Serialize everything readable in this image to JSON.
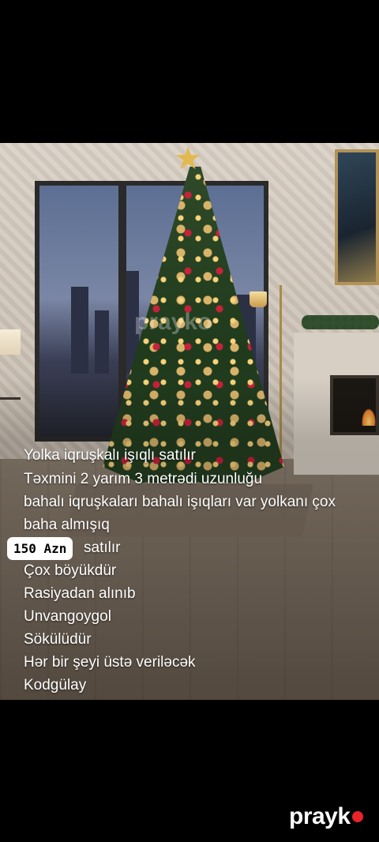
{
  "post": {
    "lines": [
      "Yolka iqruşkalı işıqlı satılır",
      "Təxmini 2 yarım 3 metrədi uzunluğu",
      "bahalı iqruşkaları bahalı işıqları var yolkanı çox",
      "baha almışıq",
      "satılır",
      "Çox böyükdür",
      "Rasiyadan alınıb",
      "Unvangoygol",
      "Sökülüdür",
      "Hər bir şeyi üstə veriləcək",
      "Kodgülay"
    ],
    "price": "150 Azn"
  },
  "watermark": {
    "photo_mark": "prayko",
    "logo": "prayk"
  },
  "colors": {
    "background": "#000000",
    "caption_text": "#ffffff",
    "price_pill": "#ffffff",
    "logo_dot": "#e8232a"
  }
}
